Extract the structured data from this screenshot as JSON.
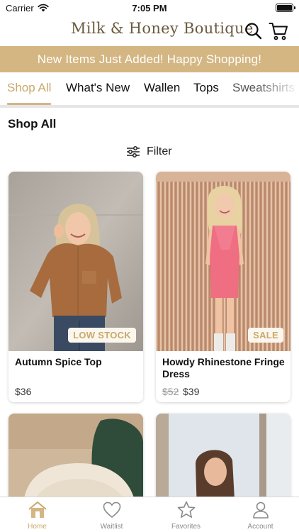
{
  "status_bar": {
    "carrier": "Carrier",
    "time": "7:05 PM",
    "battery_level": 1.0
  },
  "header": {
    "brand": "Milk & Honey Boutique"
  },
  "promo": {
    "text": "New Items Just Added! Happy Shopping!"
  },
  "tabs": [
    "Shop All",
    "What's New",
    "Wallen",
    "Tops",
    "Sweatshirts"
  ],
  "page": {
    "title": "Shop All",
    "filter_label": "Filter"
  },
  "products": [
    {
      "name": "Autumn Spice Top",
      "price": "$36",
      "badge": "LOW STOCK"
    },
    {
      "name": "Howdy Rhinestone Fringe Dress",
      "old_price": "$52",
      "price": "$39",
      "badge": "SALE"
    }
  ],
  "bottom_nav": [
    "Home",
    "Waitlist",
    "Favorites",
    "Account"
  ],
  "colors": {
    "accent": "#d4b682",
    "accent_text": "#c9a96b",
    "brand": "#6b5a3e"
  }
}
